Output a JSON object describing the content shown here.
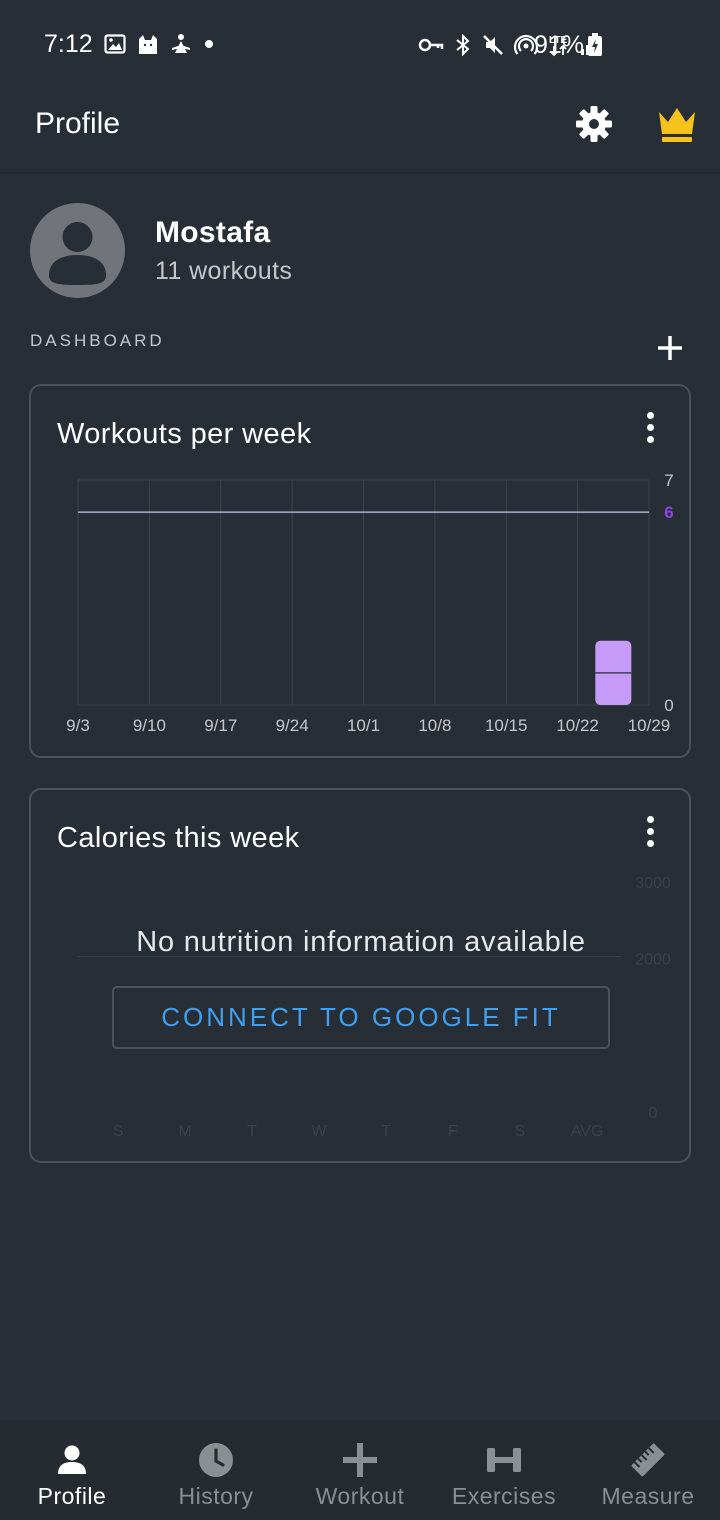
{
  "status_bar": {
    "time": "7:12",
    "battery": "91%"
  },
  "app_bar": {
    "title": "Profile",
    "crown_color": "#f6c21c"
  },
  "profile": {
    "name": "Mostafa",
    "workouts": "11 workouts"
  },
  "dashboard": {
    "label": "DASHBOARD"
  },
  "workouts_card": {
    "title": "Workouts per week",
    "chart_data": {
      "type": "bar",
      "categories": [
        "9/3",
        "9/10",
        "9/17",
        "9/24",
        "10/1",
        "10/8",
        "10/15",
        "10/22",
        "10/29"
      ],
      "values": [
        0,
        0,
        0,
        0,
        0,
        0,
        0,
        2,
        0
      ],
      "y_ticks": [
        "7",
        "6",
        "0"
      ],
      "ylim": [
        0,
        7
      ],
      "goal": 6,
      "goal_label": "6",
      "goal_color": "#8e44e8",
      "bar_color": "#c59af8",
      "grid": true
    }
  },
  "calories_card": {
    "title": "Calories this week",
    "empty_message": "No nutrition information available",
    "connect_button": "CONNECT TO GOOGLE FIT",
    "chart_data": {
      "type": "bar",
      "categories": [
        "S",
        "M",
        "T",
        "W",
        "T",
        "F",
        "S",
        "AVG"
      ],
      "values": [],
      "y_ticks": [
        "3000",
        "2000",
        "0"
      ],
      "ylim": [
        0,
        3000
      ]
    }
  },
  "bottom_nav": [
    {
      "label": "Profile",
      "icon": "person-icon",
      "active": true
    },
    {
      "label": "History",
      "icon": "clock-icon",
      "active": false
    },
    {
      "label": "Workout",
      "icon": "plus-icon",
      "active": false
    },
    {
      "label": "Exercises",
      "icon": "dumbbell-icon",
      "active": false
    },
    {
      "label": "Measure",
      "icon": "ruler-icon",
      "active": false
    }
  ]
}
